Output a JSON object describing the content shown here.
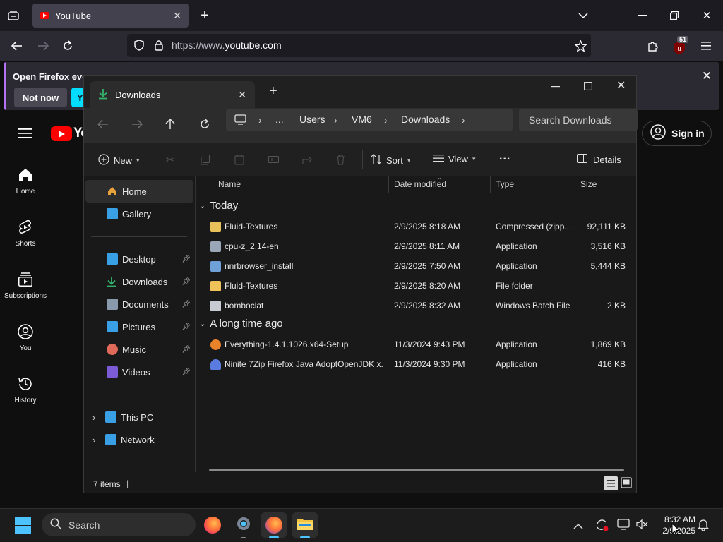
{
  "firefox": {
    "tab_title": "YouTube",
    "url_prefix": "https://www.",
    "url_domain": "youtube.com",
    "badge_count": "51",
    "notification_text": "Open Firefox ever",
    "notification_not_now": "Not now",
    "notification_primary": "Y"
  },
  "youtube": {
    "logo_text": "Yo",
    "sign_in": "Sign in",
    "sidebar": [
      {
        "label": "Home",
        "icon": "home-icon"
      },
      {
        "label": "Shorts",
        "icon": "shorts-icon"
      },
      {
        "label": "Subscriptions",
        "icon": "subscriptions-icon"
      },
      {
        "label": "You",
        "icon": "you-icon"
      },
      {
        "label": "History",
        "icon": "history-icon"
      }
    ]
  },
  "explorer": {
    "tab_title": "Downloads",
    "breadcrumbs": [
      "...",
      "Users",
      "VM6",
      "Downloads"
    ],
    "search_placeholder": "Search Downloads",
    "toolbar": {
      "new": "New",
      "sort": "Sort",
      "view": "View",
      "more": "...",
      "details": "Details"
    },
    "nav": [
      {
        "label": "Home",
        "color": "#e8a23b",
        "pinned": false,
        "selected": true
      },
      {
        "label": "Gallery",
        "color": "#3aa0e6",
        "pinned": false
      },
      {
        "label": "Desktop",
        "color": "#3aa0e6",
        "pinned": true
      },
      {
        "label": "Downloads",
        "color": "#34b36b",
        "pinned": true
      },
      {
        "label": "Documents",
        "color": "#8a9aad",
        "pinned": true
      },
      {
        "label": "Pictures",
        "color": "#3aa0e6",
        "pinned": true
      },
      {
        "label": "Music",
        "color": "#e06a5a",
        "pinned": true
      },
      {
        "label": "Videos",
        "color": "#7b5bd6",
        "pinned": true
      },
      {
        "label": "This PC",
        "color": "#3aa0e6",
        "pinned": false
      },
      {
        "label": "Network",
        "color": "#3aa0e6",
        "pinned": false
      }
    ],
    "columns": [
      "Name",
      "Date modified",
      "Type",
      "Size"
    ],
    "groups": [
      {
        "title": "Today",
        "files": [
          {
            "name": "Fluid-Textures",
            "date": "2/9/2025 8:18 AM",
            "type": "Compressed (zipp...",
            "size": "92,111 KB",
            "icon_color": "#e8c15a"
          },
          {
            "name": "cpu-z_2.14-en",
            "date": "2/9/2025 8:11 AM",
            "type": "Application",
            "size": "3,516 KB",
            "icon_color": "#9aa7b8"
          },
          {
            "name": "nnrbrowser_install",
            "date": "2/9/2025 7:50 AM",
            "type": "Application",
            "size": "5,444 KB",
            "icon_color": "#6fa0d8"
          },
          {
            "name": "Fluid-Textures",
            "date": "2/9/2025 8:20 AM",
            "type": "File folder",
            "size": "",
            "icon_color": "#f0c35a"
          },
          {
            "name": "bomboclat",
            "date": "2/9/2025 8:32 AM",
            "type": "Windows Batch File",
            "size": "2 KB",
            "icon_color": "#c8ccd2"
          }
        ]
      },
      {
        "title": "A long time ago",
        "files": [
          {
            "name": "Everything-1.4.1.1026.x64-Setup",
            "date": "11/3/2024 9:43 PM",
            "type": "Application",
            "size": "1,869 KB",
            "icon_color": "#e8832a"
          },
          {
            "name": "Ninite 7Zip Firefox Java AdoptOpenJDK x...",
            "date": "11/3/2024 9:30 PM",
            "type": "Application",
            "size": "416 KB",
            "icon_color": "#5a7be0"
          }
        ]
      }
    ],
    "status": "7 items"
  },
  "taskbar": {
    "search": "Search",
    "time": "8:32 AM",
    "date": "2/9/2025"
  }
}
